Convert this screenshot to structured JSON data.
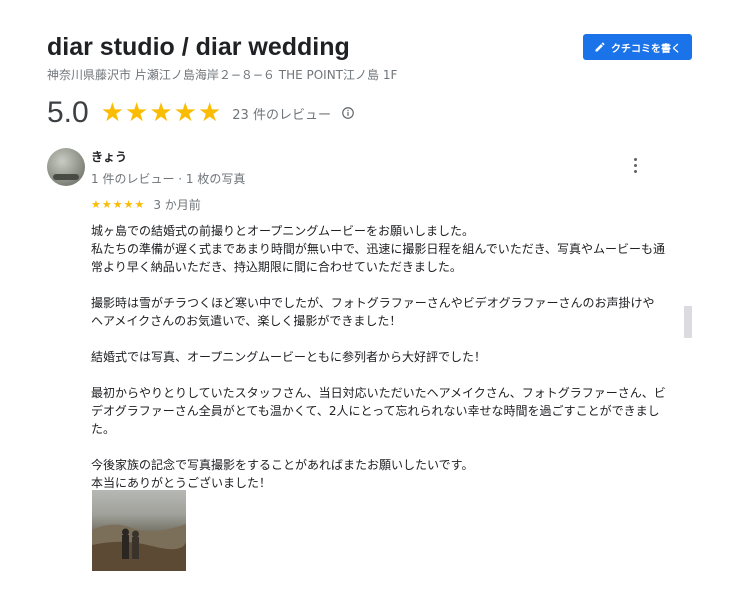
{
  "place": {
    "name": "diar studio / diar wedding",
    "address": "神奈川県藤沢市 片瀬江ノ島海岸２−８−６ THE POINT江ノ島 1F"
  },
  "write_review_button": {
    "label": "クチコミを書く",
    "icon": "pencil-icon"
  },
  "summary": {
    "rating": "5.0",
    "stars": "★★★★★",
    "review_count_text": "23 件のレビュー",
    "info_icon": "info-icon"
  },
  "review": {
    "reviewer_name": "きょう",
    "reviewer_meta": "1 件のレビュー · 1 枚の写真",
    "stars": "★★★★★",
    "time_ago": "3 か月前",
    "paragraphs": [
      "城ヶ島での結婚式の前撮りとオープニングムービーをお願いしました。\n私たちの準備が遅く式まであまり時間が無い中で、迅速に撮影日程を組んでいただき、写真やムービーも通常より早く納品いただき、持込期限に間に合わせていただきました。",
      "撮影時は雪がチラつくほど寒い中でしたが、フォトグラファーさんやビデオグラファーさんのお声掛けやヘアメイクさんのお気遣いで、楽しく撮影ができました！",
      "結婚式では写真、オープニングムービーともに参列者から大好評でした！",
      "最初からやりとりしていたスタッフさん、当日対応いただいたヘアメイクさん、フォトグラファーさん、ビデオグラファーさん全員がとても温かくて、2人にとって忘れられない幸せな時間を過ごすことができました。",
      "今後家族の記念で写真撮影をすることがあればまたお願いしたいです。\n本当にありがとうございました！"
    ]
  },
  "colors": {
    "accent": "#1a73e8",
    "star": "#fbbc04",
    "secondary_text": "#70757a"
  }
}
